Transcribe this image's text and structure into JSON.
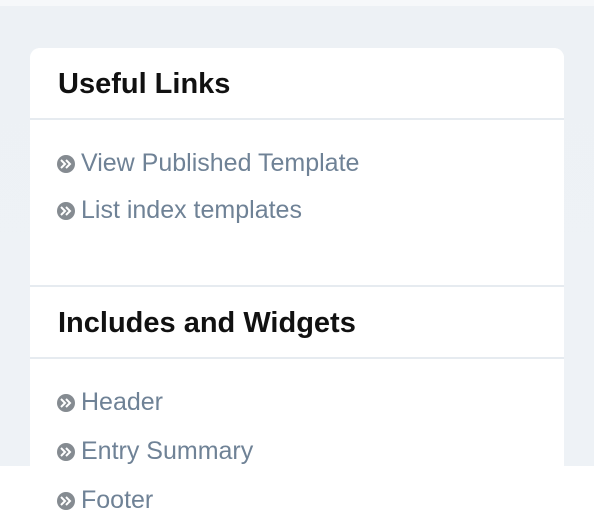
{
  "useful_links": {
    "title": "Useful Links",
    "items": [
      {
        "label": "View Published Template"
      },
      {
        "label": "List index templates"
      }
    ]
  },
  "includes_widgets": {
    "title": "Includes and Widgets",
    "items": [
      {
        "label": "Header"
      },
      {
        "label": "Entry Summary"
      },
      {
        "label": "Footer"
      }
    ]
  },
  "colors": {
    "panel_background": "#edf1f5",
    "card_background": "#ffffff",
    "link_color": "#6f8296",
    "bullet_color": "#858b91",
    "title_color": "#111111"
  }
}
